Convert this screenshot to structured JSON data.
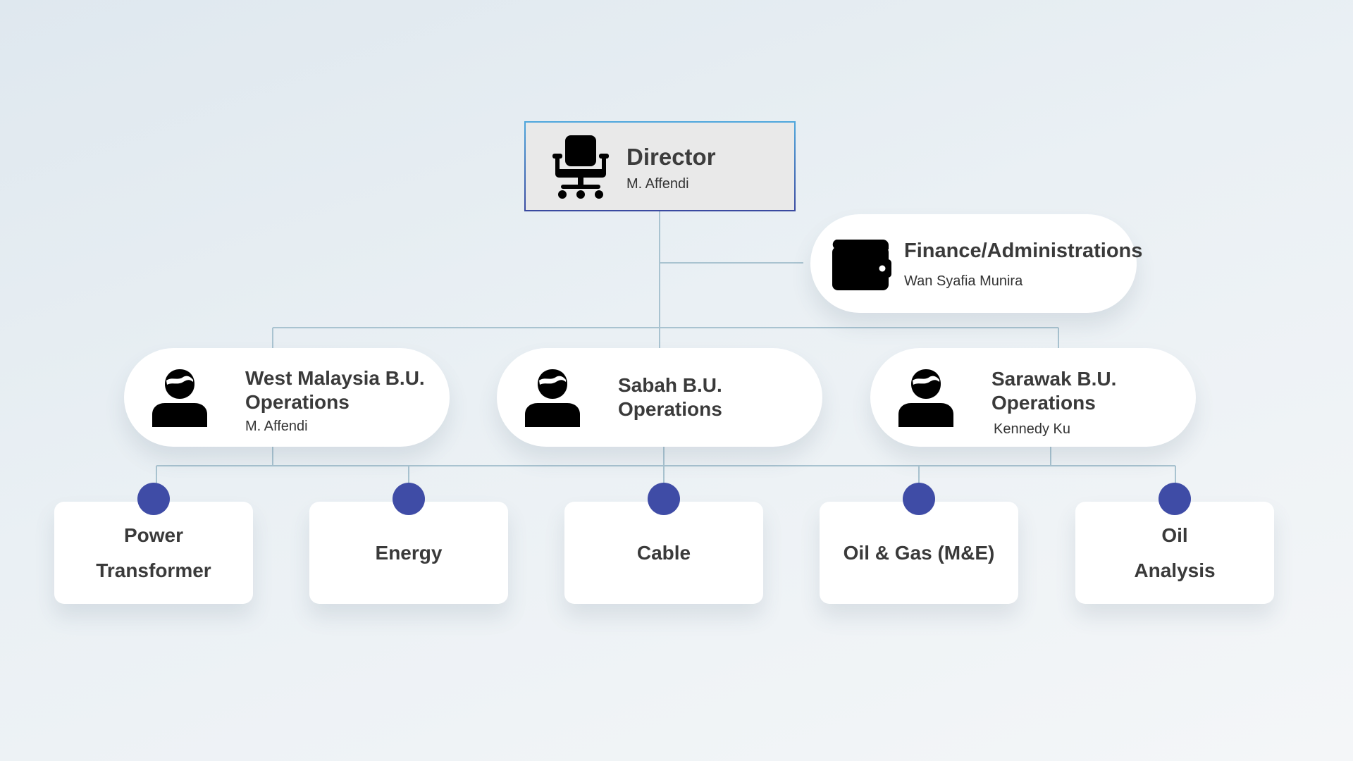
{
  "director": {
    "title": "Director",
    "person": "M. Affendi",
    "icon": "office-chair-icon"
  },
  "finance": {
    "title": "Finance/Administrations",
    "person": "Wan Syafia Munira",
    "icon": "wallet-icon"
  },
  "business_units": [
    {
      "title_line1": "West Malaysia B.U.",
      "title_line2": "Operations",
      "person": "M. Affendi",
      "icon": "person-icon"
    },
    {
      "title_line1": "Sabah B.U.",
      "title_line2": "Operations",
      "person": "",
      "icon": "person-icon"
    },
    {
      "title_line1": "Sarawak B.U.",
      "title_line2": "Operations",
      "person": "Kennedy Ku",
      "icon": "person-icon"
    }
  ],
  "divisions": [
    {
      "line1": "Power",
      "line2": "Transformer"
    },
    {
      "line1": "Energy",
      "line2": ""
    },
    {
      "line1": "Cable",
      "line2": ""
    },
    {
      "line1": "Oil & Gas (M&E)",
      "line2": ""
    },
    {
      "line1": "Oil",
      "line2": "Analysis"
    }
  ],
  "colors": {
    "connector": "#a9c3d0",
    "accent_dot": "#3f4ca6",
    "director_border_top": "#4fa7dc",
    "director_border_bottom": "#3a4aa0"
  }
}
